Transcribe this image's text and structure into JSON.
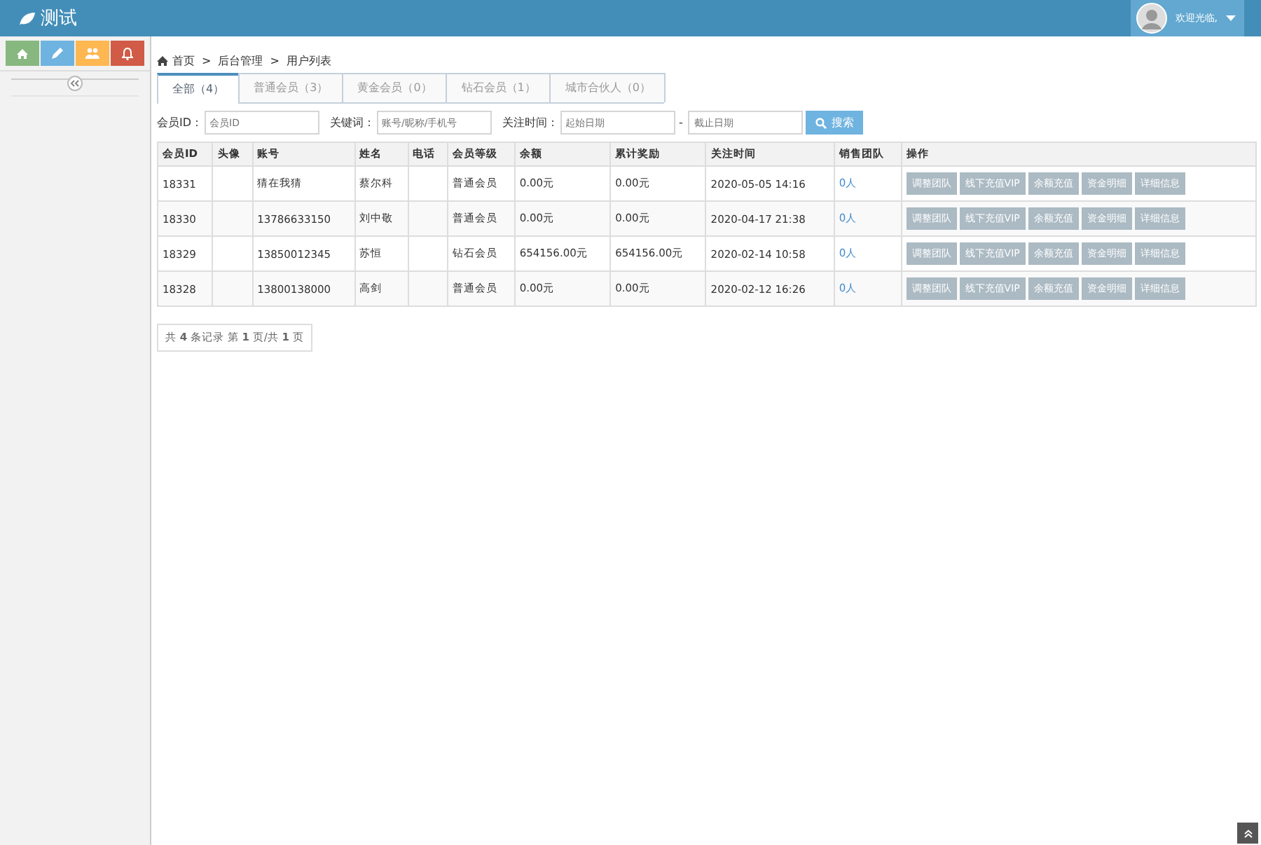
{
  "header": {
    "title": "测试",
    "welcome": "欢迎光临,"
  },
  "breadcrumb": {
    "items": [
      "首页",
      "后台管理",
      "用户列表"
    ],
    "separator": ">"
  },
  "tabs": [
    {
      "label": "全部（4）",
      "selected": true
    },
    {
      "label": "普通会员（3）",
      "selected": false
    },
    {
      "label": "黄金会员（0）",
      "selected": false
    },
    {
      "label": "钻石会员（1）",
      "selected": false
    },
    {
      "label": "城市合伙人（0）",
      "selected": false
    }
  ],
  "filters": {
    "member_id_label": "会员ID：",
    "member_id_placeholder": "会员ID",
    "keyword_label": "关键词：",
    "keyword_placeholder": "账号/昵称/手机号",
    "time_label": "关注时间：",
    "start_placeholder": "起始日期",
    "separator": "-",
    "end_placeholder": "截止日期",
    "search_button": "搜索"
  },
  "table": {
    "columns": [
      "会员ID",
      "头像",
      "账号",
      "姓名",
      "电话",
      "会员等级",
      "余额",
      "累计奖励",
      "关注时间",
      "销售团队",
      "操作"
    ],
    "rows": [
      {
        "id": "18331",
        "account": "猜在我猜",
        "name": "蔡尔科",
        "level": "普通会员",
        "balance": "0.00元",
        "reward": "0.00元",
        "time": "2020-05-05 14:16",
        "team": "0人",
        "actions": [
          "调整团队",
          "线下充值VIP",
          "余额充值",
          "资金明细",
          "详细信息"
        ]
      },
      {
        "id": "18330",
        "account": "13786633150",
        "name": "刘中敬",
        "level": "普通会员",
        "balance": "0.00元",
        "reward": "0.00元",
        "time": "2020-04-17 21:38",
        "team": "0人",
        "actions": [
          "调整团队",
          "线下充值VIP",
          "余额充值",
          "资金明细",
          "详细信息"
        ]
      },
      {
        "id": "18329",
        "account": "13850012345",
        "name": "苏恒",
        "level": "钻石会员",
        "balance": "654156.00元",
        "reward": "654156.00元",
        "time": "2020-02-14 10:58",
        "team": "0人",
        "actions": [
          "调整团队",
          "线下充值VIP",
          "余额充值",
          "资金明细",
          "详细信息"
        ]
      },
      {
        "id": "18328",
        "account": "13800138000",
        "name": "高剑",
        "level": "普通会员",
        "balance": "0.00元",
        "reward": "0.00元",
        "time": "2020-02-12 16:26",
        "team": "0人",
        "actions": [
          "调整团队",
          "线下充值VIP",
          "余额充值",
          "资金明细",
          "详细信息"
        ]
      }
    ]
  },
  "pagination": "共 **4** 条记录 第 **1** 页/共 **1** 页"
}
